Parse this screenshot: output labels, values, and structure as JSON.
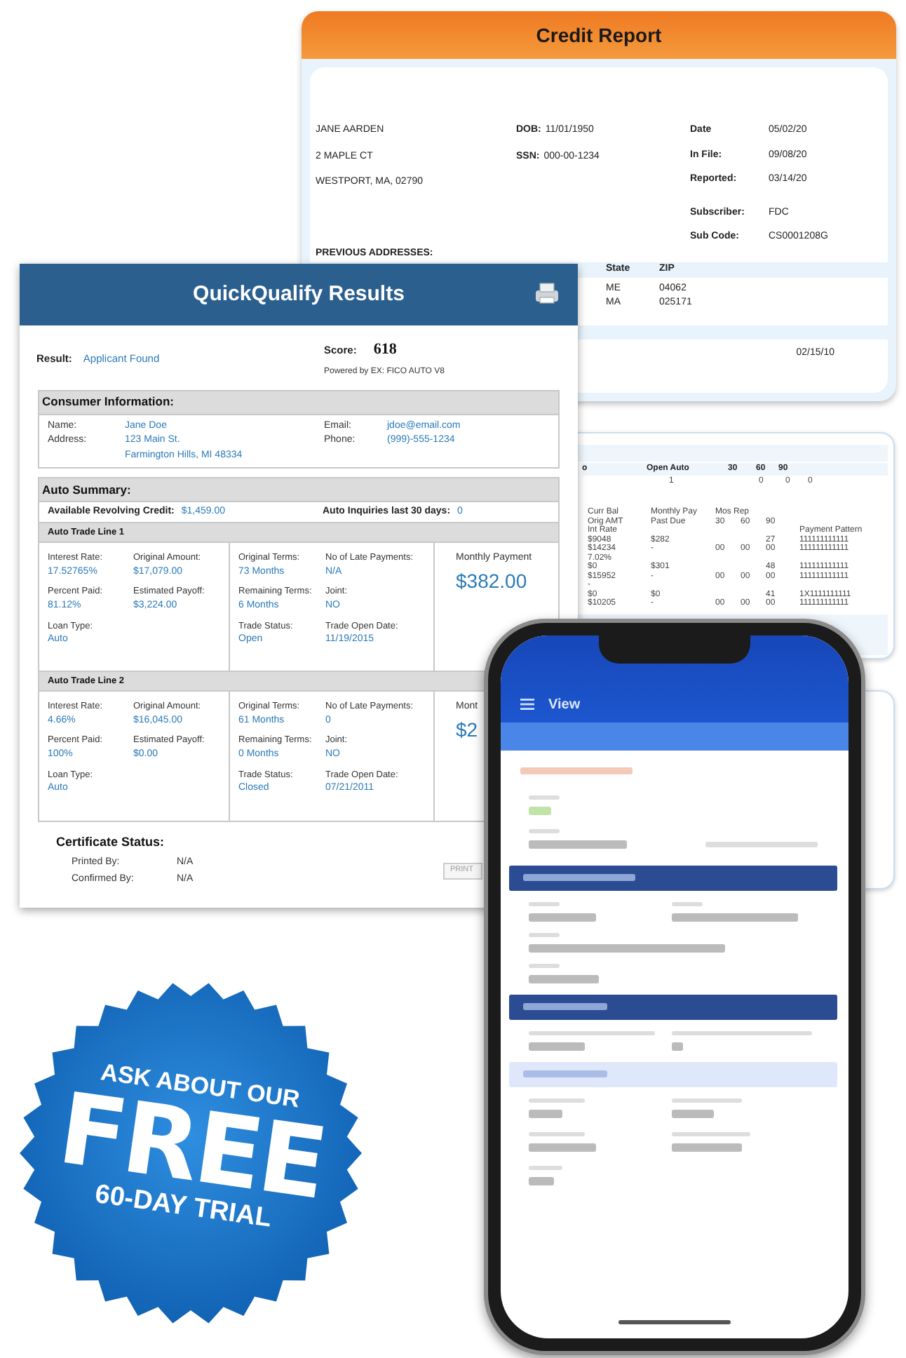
{
  "credit_report": {
    "title": "Credit Report",
    "name_lines": [
      "JANE AARDEN",
      "2 MAPLE CT",
      "WESTPORT, MA, 02790"
    ],
    "id_fields": [
      {
        "label": "DOB:",
        "value": "11/01/1950"
      },
      {
        "label": "SSN:",
        "value": "000-00-1234"
      }
    ],
    "file_fields": [
      {
        "label": "Date",
        "value": "05/02/20"
      },
      {
        "label": "In File:",
        "value": "09/08/20"
      },
      {
        "label": "Reported:",
        "value": "03/14/20"
      },
      {
        "label": "Subscriber:",
        "value": "FDC"
      },
      {
        "label": "Sub Code:",
        "value": "CS0001208G"
      }
    ],
    "previous_addresses_label": "PREVIOUS ADDRESSES:",
    "address_columns": [
      "State",
      "ZIP"
    ],
    "addresses": [
      {
        "state": "ME",
        "zip": "04062"
      },
      {
        "state": "MA",
        "zip": "025171"
      }
    ],
    "date": "02/15/10"
  },
  "trade_card": {
    "summary_columns": [
      "o",
      "Open Auto",
      "30",
      "60",
      "90"
    ],
    "summary_values": [
      "1",
      "0",
      "0",
      "0"
    ],
    "column_groups": [
      [
        "Curr Bal",
        "Orig AMT",
        "Int Rate"
      ],
      [
        "Monthly Pay",
        "Past Due"
      ],
      [
        "Mos Rep"
      ]
    ],
    "late_columns": [
      "30",
      "60",
      "90"
    ],
    "pattern_column": "Payment Pattern",
    "rows": [
      {
        "balances": [
          "$9048",
          "$14234",
          "7.02%"
        ],
        "payments": [
          "$282",
          "-"
        ],
        "months": "27",
        "late": [
          "00",
          "00",
          "00"
        ],
        "patterns": [
          "111111111111",
          "111111111111"
        ]
      },
      {
        "balances": [
          "$0",
          "$15952",
          "-"
        ],
        "payments": [
          "$301",
          "-"
        ],
        "months": "48",
        "late": [
          "00",
          "00",
          "00"
        ],
        "patterns": [
          "111111111111",
          "111111111111"
        ]
      },
      {
        "balances": [
          "$0",
          "$10205"
        ],
        "payments": [
          "$0",
          "-"
        ],
        "months": "41",
        "late": [
          "00",
          "00",
          "00"
        ],
        "patterns": [
          "1X1111111111",
          "111111111111"
        ]
      }
    ]
  },
  "quickqualify": {
    "title": "QuickQualify Results",
    "result_label": "Result:",
    "result": "Applicant Found",
    "score_label": "Score:",
    "score": "618",
    "powered_by": "Powered by EX: FICO AUTO V8",
    "consumer": {
      "title": "Consumer Information:",
      "left": [
        {
          "label": "Name:",
          "values": [
            "Jane Doe"
          ]
        },
        {
          "label": "Address:",
          "values": [
            "123 Main St.",
            "Farmington Hills, MI 48334"
          ]
        }
      ],
      "right": [
        {
          "label": "Email:",
          "values": [
            "jdoe@email.com"
          ]
        },
        {
          "label": "Phone:",
          "values": [
            "(999)-555-1234"
          ]
        }
      ]
    },
    "auto_summary": {
      "title": "Auto Summary:",
      "items": [
        {
          "label": "Available Revolving Credit:",
          "value": "$1,459.00"
        },
        {
          "label": "Auto Inquiries last 30 days:",
          "value": "0"
        }
      ]
    },
    "trade_lines": [
      {
        "title": "Auto Trade Line 1",
        "left": [
          {
            "label": "Interest Rate:",
            "value": "17.52765%"
          },
          {
            "label": "Original Amount:",
            "value": "$17,079.00"
          },
          {
            "label": "Percent Paid:",
            "value": "81.12%"
          },
          {
            "label": "Estimated Payoff:",
            "value": "$3,224.00"
          },
          {
            "label": "Loan Type:",
            "value": "Auto"
          }
        ],
        "middle": [
          {
            "label": "Original Terms:",
            "value": "73 Months"
          },
          {
            "label": "No of Late Payments:",
            "value": "N/A"
          },
          {
            "label": "Remaining Terms:",
            "value": "6 Months"
          },
          {
            "label": "Joint:",
            "value": "NO"
          },
          {
            "label": "Trade Status:",
            "value": "Open"
          },
          {
            "label": "Trade Open Date:",
            "value": "11/19/2015"
          }
        ],
        "payment_label": "Monthly Payment",
        "payment": "$382.00"
      },
      {
        "title": "Auto Trade Line 2",
        "left": [
          {
            "label": "Interest Rate:",
            "value": "4.66%"
          },
          {
            "label": "Original Amount:",
            "value": "$16,045.00"
          },
          {
            "label": "Percent Paid:",
            "value": "100%"
          },
          {
            "label": "Estimated Payoff:",
            "value": "$0.00"
          },
          {
            "label": "Loan Type:",
            "value": "Auto"
          }
        ],
        "middle": [
          {
            "label": "Original Terms:",
            "value": "61 Months"
          },
          {
            "label": "No of Late Payments:",
            "value": "0"
          },
          {
            "label": "Remaining Terms:",
            "value": "0 Months"
          },
          {
            "label": "Joint:",
            "value": "NO"
          },
          {
            "label": "Trade Status:",
            "value": "Closed"
          },
          {
            "label": "Trade Open Date:",
            "value": "07/21/2011"
          }
        ],
        "payment_label": "Mont",
        "payment": "$2"
      }
    ],
    "certificate": {
      "title": "Certificate Status:",
      "fields": [
        {
          "label": "Printed By:",
          "value": "N/A"
        },
        {
          "label": "Confirmed By:",
          "value": "N/A"
        }
      ]
    },
    "print_button": "PRINT"
  },
  "phone": {
    "title": "View"
  },
  "badge": {
    "top": "ASK ABOUT OUR",
    "main": "FREE",
    "bottom": "60-DAY TRIAL"
  }
}
